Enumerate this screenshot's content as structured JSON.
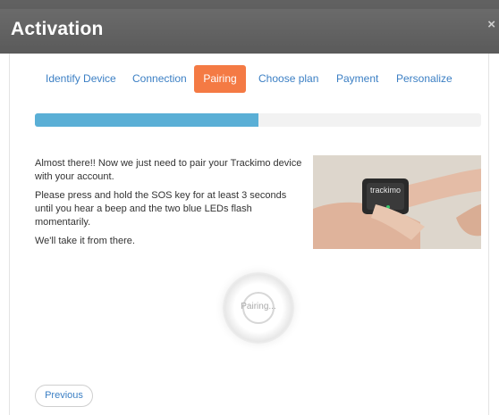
{
  "dialog": {
    "title": "Activation",
    "close_symbol": "×"
  },
  "tabs": [
    {
      "label": "Identify Device",
      "active": false
    },
    {
      "label": "Connection",
      "active": false
    },
    {
      "label": "Pairing",
      "active": true
    },
    {
      "label": "Choose plan",
      "active": false
    },
    {
      "label": "Payment",
      "active": false
    },
    {
      "label": "Personalize",
      "active": false
    }
  ],
  "progress": {
    "fraction": 0.5
  },
  "instructions": {
    "p1": "Almost there!! Now we just need to pair your Trackimo device with your account.",
    "p2": "Please press and hold the SOS key for at least 3 seconds until you hear a beep and the two blue LEDs flash momentarily.",
    "p3": "We'll take it from there."
  },
  "photo": {
    "device_label": "trackimo"
  },
  "spinner": {
    "label": "Pairing..."
  },
  "footer": {
    "previous_label": "Previous"
  },
  "colors": {
    "header": "#626262",
    "accent": "#f47a44",
    "link": "#3b7fc4",
    "progress": "#5aafd6"
  }
}
